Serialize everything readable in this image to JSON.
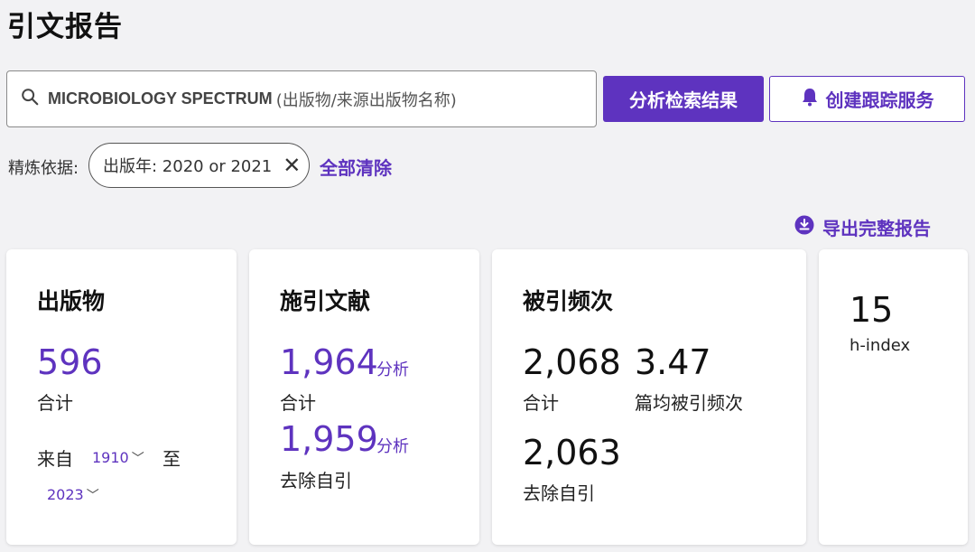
{
  "page": {
    "title": "引文报告"
  },
  "search": {
    "query": "MICROBIOLOGY SPECTRUM",
    "field_hint": "(出版物/来源出版物名称)"
  },
  "actions": {
    "analyze_label": "分析检索结果",
    "alert_label": "创建跟踪服务",
    "export_label": "导出完整报告"
  },
  "refine": {
    "label": "精炼依据:",
    "chip_label": "出版年: 2020 or 2021",
    "clear_label": "全部清除"
  },
  "cards": {
    "publications": {
      "title": "出版物",
      "total": "596",
      "total_label": "合计",
      "from_label": "来自",
      "from_year": "1910",
      "to_label": "至",
      "to_year": "2023"
    },
    "citing": {
      "title": "施引文献",
      "total": "1,964",
      "total_label": "合计",
      "analyze_label": "分析",
      "excl_self": "1,959",
      "excl_self_label": "去除自引",
      "analyze_label2": "分析"
    },
    "times_cited": {
      "title": "被引频次",
      "total": "2,068",
      "total_label": "合计",
      "average": "3.47",
      "average_label": "篇均被引频次",
      "excl_self": "2,063",
      "excl_self_label": "去除自引"
    },
    "hindex": {
      "value": "15",
      "label": "h-index"
    }
  },
  "colors": {
    "accent": "#5e33bf",
    "background": "#f2f2f4"
  },
  "icons": [
    "search-icon",
    "bell-icon",
    "close-icon",
    "download-icon",
    "chevron-down-icon"
  ]
}
